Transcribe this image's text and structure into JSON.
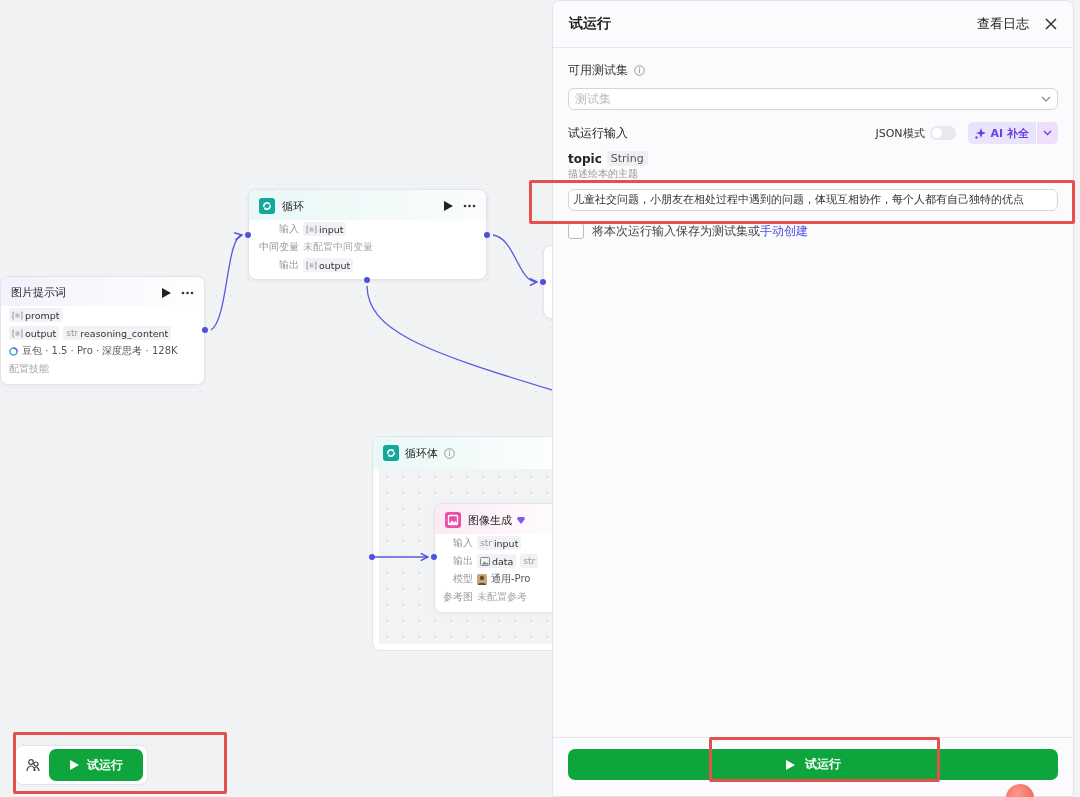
{
  "canvas": {
    "nodes": [
      {
        "kind": "llm",
        "title": "图片提示词",
        "rows": [
          {
            "tags": [
              {
                "kind": "array",
                "text": "prompt"
              }
            ]
          },
          {
            "tags": [
              {
                "kind": "array",
                "text": "output"
              },
              {
                "kind": "string",
                "type_label": "str",
                "text": "reasoning_content"
              }
            ]
          },
          {
            "model": "豆包 · 1.5 · Pro · 深度思考 · 128K"
          },
          {
            "placeholder": "配置技能"
          }
        ]
      },
      {
        "kind": "loop",
        "title": "循环",
        "rows": [
          {
            "label": "输入",
            "tags": [
              {
                "kind": "array",
                "text": "input"
              }
            ]
          },
          {
            "label": "中间变量",
            "placeholder": "未配置中间变量"
          },
          {
            "label": "输出",
            "tags": [
              {
                "kind": "array",
                "text": "output"
              }
            ]
          }
        ]
      },
      {
        "kind": "partial"
      }
    ],
    "loop_body": {
      "title": "循环体",
      "node": {
        "kind": "image",
        "title": "图像生成",
        "rows": [
          {
            "label": "输入",
            "tags": [
              {
                "kind": "string",
                "type_label": "str",
                "text": "input"
              }
            ]
          },
          {
            "label": "输出",
            "tags": [
              {
                "kind": "image",
                "text": "data"
              },
              {
                "kind": "string",
                "type_label": "str"
              }
            ]
          },
          {
            "label": "模型",
            "model": "通用-Pro"
          },
          {
            "label": "参考图",
            "placeholder": "未配置参考"
          }
        ]
      }
    },
    "toolbar": {
      "run_button": {
        "label": "试运行",
        "highlighted": true
      }
    }
  },
  "panel": {
    "title": "试运行",
    "log_link": "查看日志",
    "test_set": {
      "label": "可用测试集",
      "placeholder": "测试集"
    },
    "input_section": {
      "label": "试运行输入",
      "json_mode": {
        "label": "JSON模式",
        "on": false
      },
      "ai_button": "AI 补全"
    },
    "params": [
      {
        "name": "topic",
        "type": "String",
        "description": "描述绘本的主题",
        "value": "儿童社交问题，小朋友在相处过程中遇到的问题，体现互相协作，每个人都有自己独特的优点",
        "highlighted": true
      }
    ],
    "save_option": {
      "checked": false,
      "text": "将本次运行输入保存为测试集或",
      "link": "手动创建"
    },
    "run_button": {
      "label": "试运行",
      "highlighted": true
    }
  }
}
